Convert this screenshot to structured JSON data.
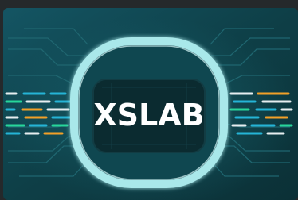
{
  "logo": {
    "text": "XSLAB"
  },
  "colors": {
    "background": "#0e3f47",
    "frame_dark": "#23292b",
    "ring": "#a9e8ea",
    "inner_panel": "#0b2b30",
    "circuit": "#1f6670",
    "dash_orange": "#f2a028",
    "dash_blue": "#25b4d6",
    "dash_green": "#27d69a",
    "dash_white": "#e6eef0",
    "logo_text": "#ffffff"
  }
}
